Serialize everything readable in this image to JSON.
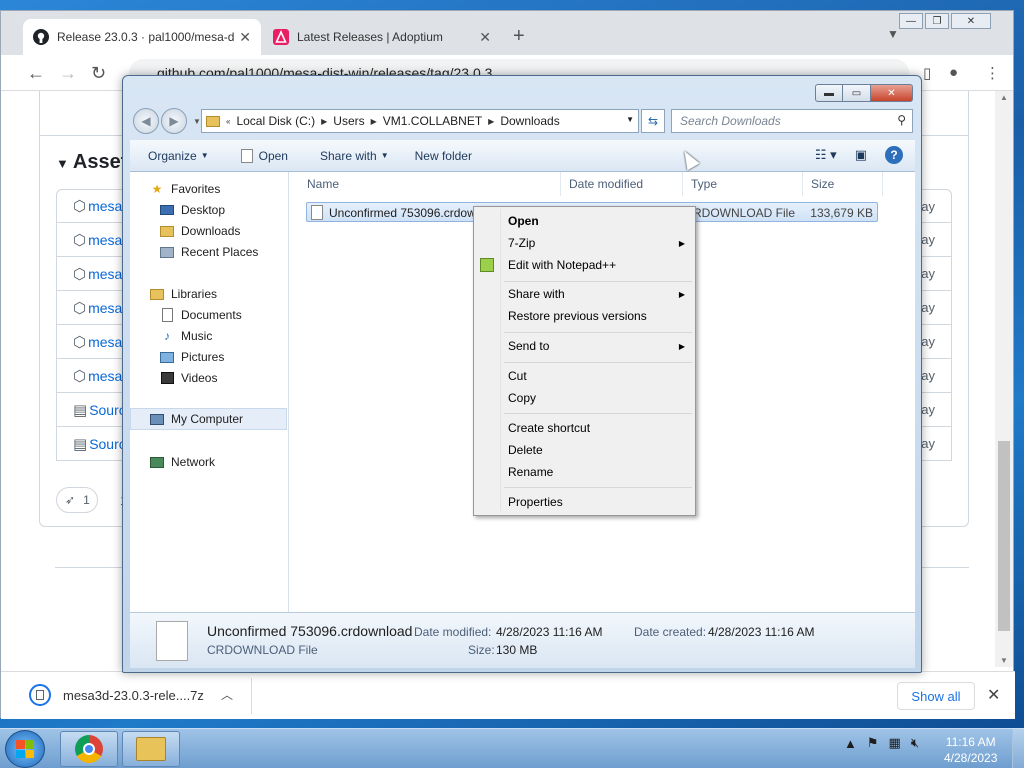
{
  "chrome": {
    "tabs": [
      {
        "title": "Release 23.0.3 · pal1000/mesa-di",
        "active": true
      },
      {
        "title": "Latest Releases | Adoptium",
        "active": false
      }
    ],
    "url": "github.com/pal1000/mesa-dist-win/releases/tag/23.0.3"
  },
  "github": {
    "assets_title": "Assets",
    "assets": [
      {
        "name": "mesa",
        "kind": "package",
        "date": "ay"
      },
      {
        "name": "mesa",
        "kind": "package",
        "date": "ay"
      },
      {
        "name": "mesa",
        "kind": "package",
        "date": "ay"
      },
      {
        "name": "mesa",
        "kind": "package",
        "date": "ay"
      },
      {
        "name": "mesa",
        "kind": "package",
        "date": "ay"
      },
      {
        "name": "mesa",
        "kind": "package",
        "date": "ay"
      },
      {
        "name": "Sourc",
        "kind": "zip",
        "date": "ay"
      },
      {
        "name": "Sourc",
        "kind": "zip",
        "date": "ay"
      }
    ],
    "reaction_count": "1",
    "reaction_text": "1 p"
  },
  "download_shelf": {
    "filename": "mesa3d-23.0.3-rele....7z",
    "show_all": "Show all"
  },
  "explorer": {
    "address": [
      "Local Disk (C:)",
      "Users",
      "VM1.COLLABNET",
      "Downloads"
    ],
    "search_placeholder": "Search Downloads",
    "toolbar": {
      "organize": "Organize",
      "open": "Open",
      "share_with": "Share with",
      "new_folder": "New folder"
    },
    "nav": {
      "favorites": "Favorites",
      "desktop": "Desktop",
      "downloads": "Downloads",
      "recent_places": "Recent Places",
      "libraries": "Libraries",
      "documents": "Documents",
      "music": "Music",
      "pictures": "Pictures",
      "videos": "Videos",
      "my_computer": "My Computer",
      "network": "Network"
    },
    "columns": {
      "name": "Name",
      "date_modified": "Date modified",
      "type": "Type",
      "size": "Size"
    },
    "file": {
      "name": "Unconfirmed 753096.crdow",
      "type": "RDOWNLOAD File",
      "size": "133,679 KB"
    },
    "details": {
      "name": "Unconfirmed 753096.crdownload",
      "type": "CRDOWNLOAD File",
      "date_modified_label": "Date modified:",
      "date_modified": "4/28/2023 11:16 AM",
      "date_created_label": "Date created:",
      "date_created": "4/28/2023 11:16 AM",
      "size_label": "Size:",
      "size": "130 MB"
    }
  },
  "context_menu": {
    "open": "Open",
    "seven_zip": "7-Zip",
    "edit_npp": "Edit with Notepad++",
    "share_with": "Share with",
    "restore": "Restore previous versions",
    "send_to": "Send to",
    "cut": "Cut",
    "copy": "Copy",
    "create_shortcut": "Create shortcut",
    "delete": "Delete",
    "rename": "Rename",
    "properties": "Properties"
  },
  "taskbar": {
    "time": "11:16 AM",
    "date": "4/28/2023"
  },
  "colors": {
    "accent": "#1a73e8",
    "github_link": "#0969da",
    "explorer_selection": "#cfe2f7"
  }
}
